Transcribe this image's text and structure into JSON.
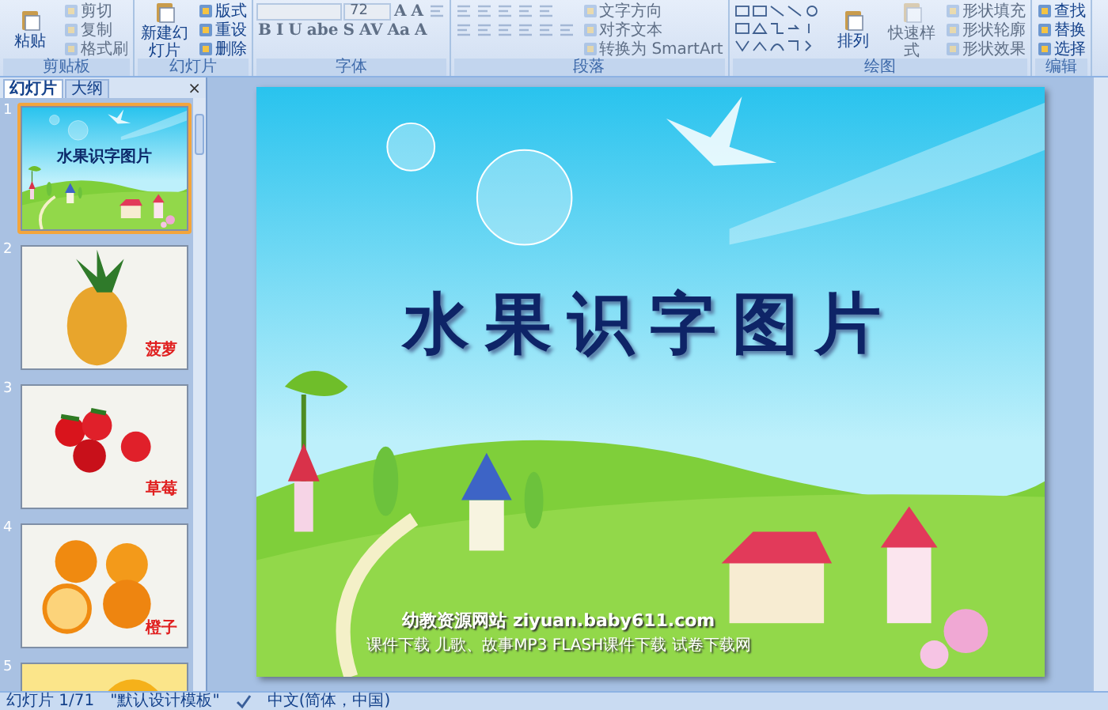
{
  "ribbon": {
    "groups": [
      {
        "label": "剪贴板",
        "columns": [
          [
            [
              {
                "kind": "large",
                "label": "粘贴",
                "disabled": false
              }
            ]
          ],
          [
            [
              {
                "kind": "small",
                "label": "剪切",
                "disabled": true
              }
            ],
            [
              {
                "kind": "small",
                "label": "复制",
                "disabled": true
              }
            ],
            [
              {
                "kind": "small",
                "label": "格式刷",
                "disabled": true
              }
            ]
          ]
        ]
      },
      {
        "label": "幻灯片",
        "columns": [
          [
            [
              {
                "kind": "large",
                "label": "新建幻灯片",
                "disabled": false
              }
            ]
          ],
          [
            [
              {
                "kind": "small",
                "label": "版式",
                "disabled": false
              }
            ],
            [
              {
                "kind": "small",
                "label": "重设",
                "disabled": false
              }
            ],
            [
              {
                "kind": "small",
                "label": "删除",
                "disabled": false
              }
            ]
          ]
        ]
      },
      {
        "label": "字体",
        "columns": [
          [
            [
              {
                "kind": "field",
                "disabled": true
              },
              {
                "kind": "field",
                "value": "72",
                "disabled": true
              },
              {
                "kind": "glyph",
                "label": "A",
                "disabled": true
              },
              {
                "kind": "glyph",
                "label": "A",
                "disabled": true
              },
              {
                "kind": "icon",
                "disabled": true
              }
            ],
            [
              {
                "kind": "glyph",
                "label": "B",
                "disabled": true
              },
              {
                "kind": "glyph",
                "label": "I",
                "disabled": true
              },
              {
                "kind": "glyph",
                "label": "U",
                "disabled": true
              },
              {
                "kind": "glyph",
                "label": "abe",
                "disabled": true
              },
              {
                "kind": "glyph",
                "label": "S",
                "disabled": true
              },
              {
                "kind": "glyph",
                "label": "AV",
                "disabled": true
              },
              {
                "kind": "glyph",
                "label": "Aa",
                "disabled": true
              },
              {
                "kind": "glyph",
                "label": "A",
                "disabled": true
              }
            ]
          ]
        ]
      },
      {
        "label": "段落",
        "columns": [
          [
            [
              {
                "kind": "icon",
                "disabled": true
              },
              {
                "kind": "icon",
                "disabled": true
              },
              {
                "kind": "icon",
                "disabled": true
              },
              {
                "kind": "icon",
                "disabled": true
              },
              {
                "kind": "icon",
                "disabled": true
              }
            ],
            [
              {
                "kind": "icon",
                "disabled": true
              },
              {
                "kind": "icon",
                "disabled": true
              },
              {
                "kind": "icon",
                "disabled": true
              },
              {
                "kind": "icon",
                "disabled": true
              },
              {
                "kind": "icon",
                "disabled": true
              },
              {
                "kind": "icon",
                "disabled": true
              }
            ]
          ],
          [
            [
              {
                "kind": "small",
                "label": "文字方向",
                "disabled": true
              }
            ],
            [
              {
                "kind": "small",
                "label": "对齐文本",
                "disabled": true
              }
            ],
            [
              {
                "kind": "small",
                "label": "转换为 SmartArt",
                "disabled": true
              }
            ]
          ]
        ]
      },
      {
        "label": "绘图",
        "columns": [
          [
            [
              {
                "kind": "gallery",
                "disabled": false
              }
            ]
          ],
          [
            [
              {
                "kind": "large",
                "label": "排列",
                "disabled": false
              }
            ]
          ],
          [
            [
              {
                "kind": "large",
                "label": "快速样式",
                "disabled": true
              }
            ]
          ],
          [
            [
              {
                "kind": "small",
                "label": "形状填充",
                "disabled": true
              }
            ],
            [
              {
                "kind": "small",
                "label": "形状轮廓",
                "disabled": true
              }
            ],
            [
              {
                "kind": "small",
                "label": "形状效果",
                "disabled": true
              }
            ]
          ]
        ]
      },
      {
        "label": "编辑",
        "columns": [
          [
            [
              {
                "kind": "small",
                "label": "查找",
                "disabled": false
              }
            ],
            [
              {
                "kind": "small",
                "label": "替换",
                "disabled": false
              }
            ],
            [
              {
                "kind": "small",
                "label": "选择",
                "disabled": false
              }
            ]
          ]
        ]
      }
    ]
  },
  "slides_pane": {
    "tabs": [
      {
        "label": "幻灯片",
        "selected": true
      },
      {
        "label": "大纲",
        "selected": false
      }
    ],
    "close": "×",
    "thumbnails": [
      {
        "number": "1",
        "selected": true,
        "kind": "title",
        "title": "水果识字图片"
      },
      {
        "number": "2",
        "selected": false,
        "caption": "菠萝"
      },
      {
        "number": "3",
        "selected": false,
        "caption": "草莓"
      },
      {
        "number": "4",
        "selected": false,
        "caption": "橙子"
      },
      {
        "number": "5",
        "selected": false
      }
    ]
  },
  "slide": {
    "title": "水果识字图片",
    "site": "幼教资源网站  ziyuan.baby611.com",
    "links": "课件下载  儿歌、故事MP3  FLASH课件下载  试卷下载网"
  },
  "status_bar": {
    "slide_info": "幻灯片 1/71",
    "theme": "\"默认设计模板\"",
    "language": "中文(简体，中国)"
  }
}
